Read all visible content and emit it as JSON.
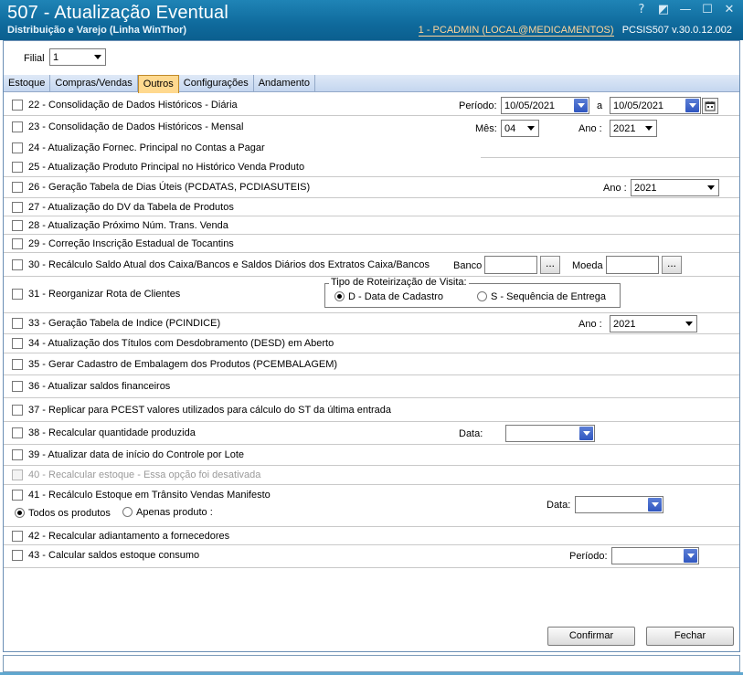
{
  "window": {
    "title": "507 - Atualização Eventual",
    "subtitle": "Distribuição e Varejo (Linha WinThor)",
    "user": "1 - PCADMIN (LOCAL@MEDICAMENTOS)",
    "version": "PCSIS507  v.30.0.12.002",
    "controls": {
      "help": "?",
      "restore": "◩",
      "minimize": "—",
      "maximize": "☐",
      "close": "✕"
    }
  },
  "filial": {
    "label": "Filial",
    "value": "1"
  },
  "tabs": [
    {
      "label": "Estoque"
    },
    {
      "label": "Compras/Vendas"
    },
    {
      "label": "Outros"
    },
    {
      "label": "Configurações"
    },
    {
      "label": "Andamento"
    }
  ],
  "rows": {
    "r22": {
      "label": "22 - Consolidação de Dados Históricos - Diária",
      "periodo_label": "Período:",
      "date_from": "10/05/2021",
      "a_label": "a",
      "date_to": "10/05/2021"
    },
    "r23": {
      "label": "23 - Consolidação de Dados Históricos - Mensal",
      "mes_label": "Mês:",
      "mes_value": "04",
      "ano_label": "Ano :",
      "ano_value": "2021"
    },
    "r24": {
      "label": "24 - Atualização Fornec. Principal no Contas a Pagar"
    },
    "r25": {
      "label": "25 - Atualização Produto Principal no Histórico Venda Produto"
    },
    "r26": {
      "label": "26 - Geração Tabela de Dias Úteis (PCDATAS, PCDIASUTEIS)",
      "ano_label": "Ano :",
      "ano_value": "2021"
    },
    "r27": {
      "label": "27 - Atualização do DV da Tabela de Produtos"
    },
    "r28": {
      "label": "28 - Atualização Próximo Núm. Trans. Venda"
    },
    "r29": {
      "label": "29 - Correção Inscrição Estadual de Tocantins"
    },
    "r30": {
      "label": "30 - Recálculo Saldo Atual dos Caixa/Bancos e Saldos Diários dos Extratos Caixa/Bancos",
      "banco_label": "Banco",
      "banco_value": "",
      "moeda_label": "Moeda",
      "moeda_value": "",
      "dots": "..."
    },
    "r31": {
      "label": "31 - Reorganizar Rota de Clientes",
      "group_label": "Tipo de Roteirização de Visita:",
      "opt_d": "D - Data de Cadastro",
      "opt_s": "S - Sequência de Entrega"
    },
    "r33": {
      "label": "33 - Geração Tabela de Indice (PCINDICE)",
      "ano_label": "Ano :",
      "ano_value": "2021"
    },
    "r34": {
      "label": "34 - Atualização dos Títulos com Desdobramento (DESD) em Aberto"
    },
    "r35": {
      "label": "35 - Gerar Cadastro de Embalagem dos Produtos (PCEMBALAGEM)"
    },
    "r36": {
      "label": "36 - Atualizar saldos financeiros"
    },
    "r37": {
      "label": "37 - Replicar para PCEST valores utilizados para cálculo do ST da última entrada"
    },
    "r38": {
      "label": "38 - Recalcular quantidade produzida",
      "data_label": "Data:",
      "data_value": ""
    },
    "r39": {
      "label": "39 - Atualizar data de início do Controle por Lote"
    },
    "r40": {
      "label": "40 - Recalcular estoque - Essa opção foi desativada"
    },
    "r41": {
      "label": "41 - Recálculo Estoque em Trânsito Vendas Manifesto",
      "opt_todos": "Todos os produtos",
      "opt_apenas": "Apenas produto :",
      "data_label": "Data:",
      "data_value": ""
    },
    "r42": {
      "label": "42 - Recalcular adiantamento a fornecedores"
    },
    "r43": {
      "label": "43 - Calcular saldos estoque consumo",
      "periodo_label": "Período:",
      "periodo_value": ""
    }
  },
  "buttons": {
    "confirm": "Confirmar",
    "close": "Fechar"
  },
  "colors": {
    "titlebar": "#0f6a9c",
    "active_tab": "#ffd98f",
    "combo_arrow": "#2f56c0"
  }
}
